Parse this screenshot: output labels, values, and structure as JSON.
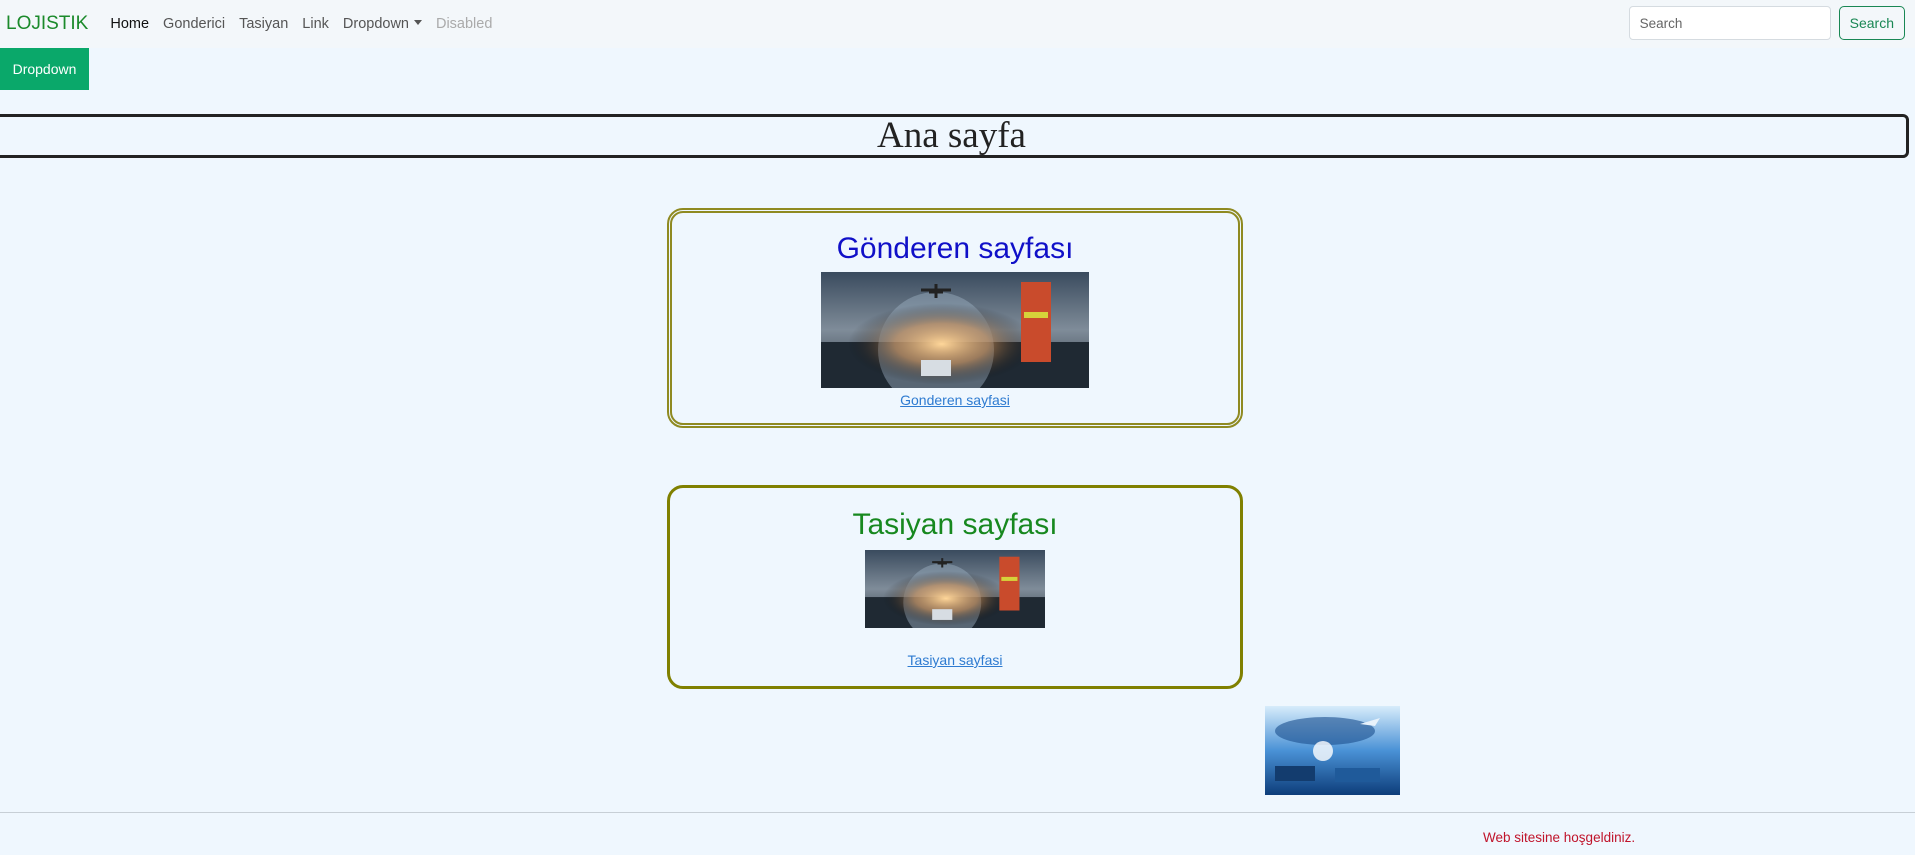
{
  "navbar": {
    "brand": "LOJISTIK",
    "links": [
      {
        "label": "Home"
      },
      {
        "label": "Gonderici"
      },
      {
        "label": "Tasiyan"
      },
      {
        "label": "Link"
      },
      {
        "label": "Dropdown"
      },
      {
        "label": "Disabled"
      }
    ],
    "search": {
      "placeholder": "Search",
      "button_label": "Search"
    }
  },
  "dropdown_button": {
    "label": "Dropdown"
  },
  "page_heading": "Ana sayfa",
  "cards": [
    {
      "title": "Gönderen sayfası",
      "link_label": "Gonderen sayfasi"
    },
    {
      "title": "Tasiyan sayfası",
      "link_label": "Tasiyan sayfasi"
    }
  ],
  "footer": {
    "text": "Web sitesine hoşgeldiniz."
  },
  "colors": {
    "brand": "#1b8a2b",
    "search_button": "#198754",
    "dropdown_button": "#0aa86a",
    "card1_title": "#1010c8",
    "card2_title": "#17881f",
    "card_border": "#808000",
    "footer_text": "#c0142b",
    "page_background": "#eff7fe"
  }
}
